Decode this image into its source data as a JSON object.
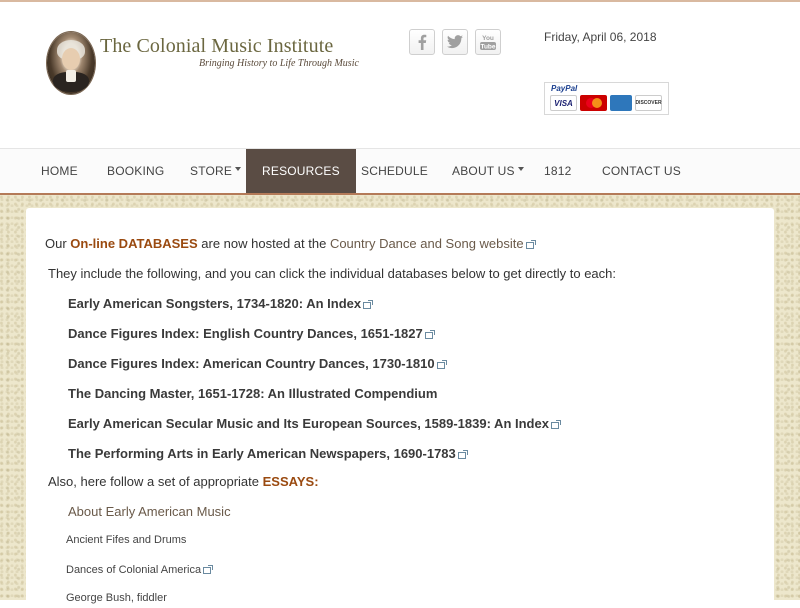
{
  "header": {
    "site_title": "The Colonial Music Institute",
    "tagline": "Bringing History to Life Through Music",
    "date": "Friday, April 06, 2018",
    "social": [
      {
        "icon": "facebook-icon",
        "glyph": "f"
      },
      {
        "icon": "twitter-icon",
        "glyph": "t"
      },
      {
        "icon": "youtube-icon",
        "glyph": "You Tube"
      }
    ],
    "paypal": {
      "brand": "PayPal",
      "cards": [
        "VISA",
        "MasterCard",
        "AMEX",
        "DISCOVER"
      ]
    }
  },
  "nav": {
    "items": [
      {
        "label": "HOME",
        "caret": false,
        "active": false
      },
      {
        "label": "BOOKING",
        "caret": false,
        "active": false
      },
      {
        "label": "STORE",
        "caret": true,
        "active": false
      },
      {
        "label": "RESOURCES",
        "caret": false,
        "active": true
      },
      {
        "label": "SCHEDULE",
        "caret": false,
        "active": false
      },
      {
        "label": "ABOUT US",
        "caret": true,
        "active": false
      },
      {
        "label": "1812",
        "caret": false,
        "active": false
      },
      {
        "label": "CONTACT US",
        "caret": false,
        "active": false
      }
    ],
    "active_color": "#5a4c44",
    "border_color": "#b47a58"
  },
  "content": {
    "intro": {
      "prefix": "Our",
      "databases_link": "On-line DATABASES",
      "middle": "are now hosted at the",
      "cds_link": "Country Dance and Song website"
    },
    "include_text": "They include the following, and you can click the individual databases below to get directly to each:",
    "databases": [
      "Early American Songsters, 1734-1820: An Index",
      "Dance Figures Index: English Country Dances, 1651-1827",
      "Dance Figures Index: American Country Dances, 1730-1810",
      "The Dancing Master, 1651-1728: An Illustrated Compendium",
      "Early American Secular Music and Its European Sources, 1589-1839: An Index",
      "The Performing Arts in Early American Newspapers, 1690-1783"
    ],
    "essays_prefix": "Also, here follow a set of appropriate",
    "essays_label": "ESSAYS:",
    "essays_heading": "About Early American Music",
    "essays": [
      "Ancient Fifes and Drums",
      "Dances of Colonial America",
      "George Bush, fiddler"
    ],
    "accent_color": "#9a4a10"
  }
}
